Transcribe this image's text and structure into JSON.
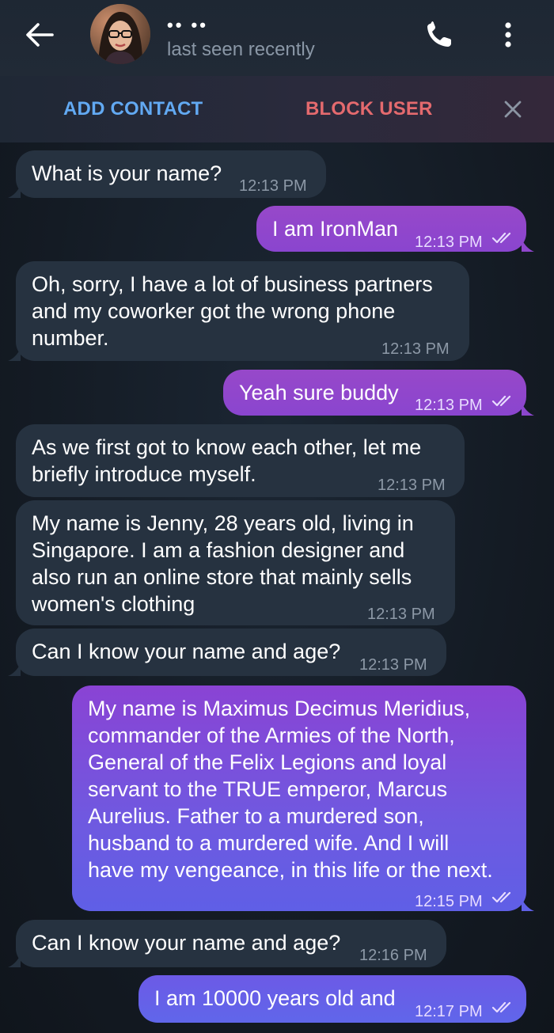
{
  "header": {
    "peer_name": "•• ••",
    "status": "last seen recently",
    "icons": [
      "back-arrow-icon",
      "avatar",
      "phone-icon",
      "more-vertical-icon"
    ]
  },
  "actions": {
    "add_contact": "ADD CONTACT",
    "block_user": "BLOCK USER",
    "close_icon": "close-icon"
  },
  "colors": {
    "incoming_bubble": "#263240",
    "outgoing_bubble": "#8e47cd",
    "add_contact": "#62a9f2",
    "block_user": "#e46a6e"
  },
  "messages": [
    {
      "dir": "in",
      "text": "What is your name?",
      "time": "12:13 PM"
    },
    {
      "dir": "out",
      "text": "I am IronMan",
      "time": "12:13 PM",
      "read": true
    },
    {
      "dir": "in",
      "text": "Oh, sorry, I have a lot of business partners\nand my coworker got the wrong phone\nnumber.",
      "time": "12:13 PM"
    },
    {
      "dir": "out",
      "text": "Yeah sure buddy",
      "time": "12:13 PM",
      "read": true
    },
    {
      "dir": "in",
      "text": "As we first got to know each other, let me\nbriefly introduce myself.",
      "time": "12:13 PM"
    },
    {
      "dir": "in",
      "text": "My name is Jenny, 28 years old, living in\nSingapore. I am a fashion designer and\nalso run an online store that mainly sells\nwomen's clothing",
      "time": "12:13 PM"
    },
    {
      "dir": "in",
      "text": "Can I know your name and age?",
      "time": "12:13 PM"
    },
    {
      "dir": "out",
      "text": "My name is Maximus Decimus Meridius,\ncommander of the Armies of the North,\nGeneral of the Felix Legions and loyal\nservant to the TRUE emperor, Marcus\nAurelius. Father to a murdered son,\nhusband to a murdered wife. And I will\nhave my vengeance, in this life or the next.",
      "time": "12:15 PM",
      "read": true
    },
    {
      "dir": "in",
      "text": "Can I know your name and age?",
      "time": "12:16 PM"
    },
    {
      "dir": "out",
      "text": "I am 10000 years old and",
      "time": "12:17 PM",
      "read": true
    }
  ]
}
